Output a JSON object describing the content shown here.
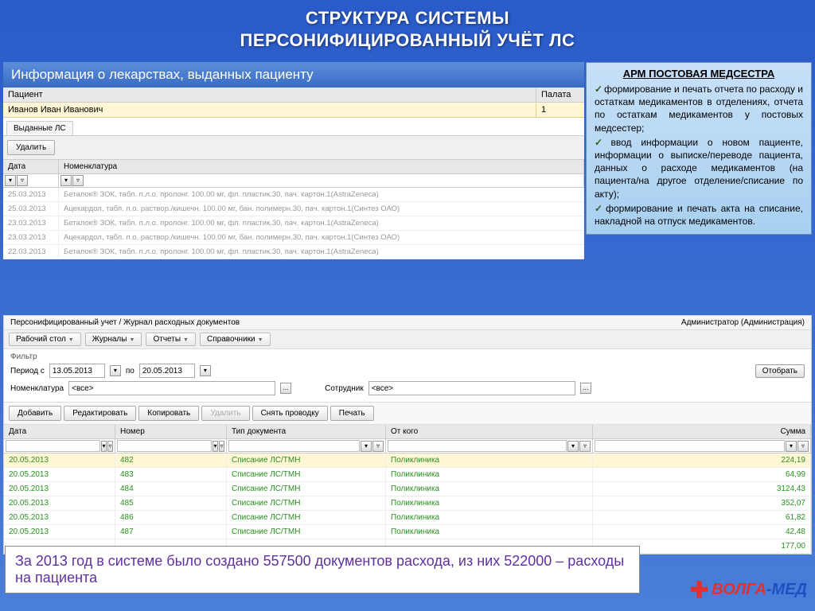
{
  "slide": {
    "line1": "СТРУКТУРА СИСТЕМЫ",
    "line2": "ПЕРСОНИФИЦИРОВАННЫЙ УЧЁТ ЛС",
    "section_header": "Информация о лекарствах, выданных пациенту"
  },
  "patient_grid": {
    "col_patient": "Пациент",
    "col_ward": "Палата",
    "name": "Иванов Иван Иванович",
    "ward": "1"
  },
  "tab": {
    "label": "Выданные ЛС"
  },
  "toolbar1": {
    "delete": "Удалить"
  },
  "grid1": {
    "col_date": "Дата",
    "col_nom": "Номенклатура",
    "rows": [
      {
        "date": "25.03.2013",
        "nom": "Беталок® ЗОК, табл. п.л.о. пролонг. 100.00 мг, фл. пластик.30, пач. картон.1(AstraZeneca)"
      },
      {
        "date": "25.03.2013",
        "nom": "Ацекардол, табл. п.о. раствор./кишечн. 100.00 мг, бан. полимерн.30, пач. картон.1(Синтез ОАО)"
      },
      {
        "date": "23.03.2013",
        "nom": "Беталок® ЗОК, табл. п.л.о. пролонг. 100.00 мг, фл. пластик.30, пач. картон.1(AstraZeneca)"
      },
      {
        "date": "23.03.2013",
        "nom": "Ацекардол, табл. п.о. раствор./кишечн. 100.00 мг, бан. полимерн.30, пач. картон.1(Синтез ОАО)"
      },
      {
        "date": "22.03.2013",
        "nom": "Беталок® ЗОК, табл. п.л.о. пролонг. 100.00 мг, фл. пластик.30, пач. картон.1(AstraZeneca)"
      }
    ]
  },
  "sidebar": {
    "title": "АРМ ПОСТОВАЯ МЕДСЕСТРА",
    "items": [
      "формирование и печать отчета по расходу и остаткам медикаментов в отделениях, отчета по остаткам медикаментов у постовых медсестер;",
      "ввод информации о новом пациенте, информации о выписке/переводе пациента, данных о расходе медикаментов (на пациента/на другое отделение/списание по акту);",
      "формирование и печать акта на списание, накладной на отпуск медикаментов."
    ]
  },
  "panel2": {
    "breadcrumb": "Персонифицированный учет / Журнал расходных документов",
    "user": "Администратор (Администрация)",
    "menu": {
      "desktop": "Рабочий стол",
      "journals": "Журналы",
      "reports": "Отчеты",
      "refs": "Справочники"
    },
    "filter": {
      "header": "Фильтр",
      "period_label": "Период с",
      "to_label": "по",
      "from": "13.05.2013",
      "to": "20.05.2013",
      "nom_label": "Номенклатура",
      "all": "<все>",
      "emp_label": "Сотрудник",
      "select": "Отобрать"
    },
    "toolbar": {
      "add": "Добавить",
      "edit": "Редактировать",
      "copy": "Копировать",
      "delete": "Удалить",
      "unpost": "Снять проводку",
      "print": "Печать"
    },
    "grid": {
      "col_date": "Дата",
      "col_num": "Номер",
      "col_type": "Тип документа",
      "col_from": "От кого",
      "col_sum": "Сумма",
      "rows": [
        {
          "date": "20.05.2013",
          "num": "482",
          "type": "Списание ЛС/ТМН",
          "from": "Поликлиника",
          "sum": "224,19"
        },
        {
          "date": "20.05.2013",
          "num": "483",
          "type": "Списание ЛС/ТМН",
          "from": "Поликлиника",
          "sum": "64,99"
        },
        {
          "date": "20.05.2013",
          "num": "484",
          "type": "Списание ЛС/ТМН",
          "from": "Поликлиника",
          "sum": "3124,43"
        },
        {
          "date": "20.05.2013",
          "num": "485",
          "type": "Списание ЛС/ТМН",
          "from": "Поликлиника",
          "sum": "352,07"
        },
        {
          "date": "20.05.2013",
          "num": "486",
          "type": "Списание ЛС/ТМН",
          "from": "Поликлиника",
          "sum": "61,82"
        },
        {
          "date": "20.05.2013",
          "num": "487",
          "type": "Списание ЛС/ТМН",
          "from": "Поликлиника",
          "sum": "42,48"
        },
        {
          "date": "",
          "num": "",
          "type": "",
          "from": "",
          "sum": "177,00"
        }
      ]
    }
  },
  "footnote": "За 2013 год в системе было создано 557500 документов расхода, из них 522000 – расходы на пациента",
  "logo": {
    "v": "ВОЛГА",
    "m": "-МЕД"
  }
}
